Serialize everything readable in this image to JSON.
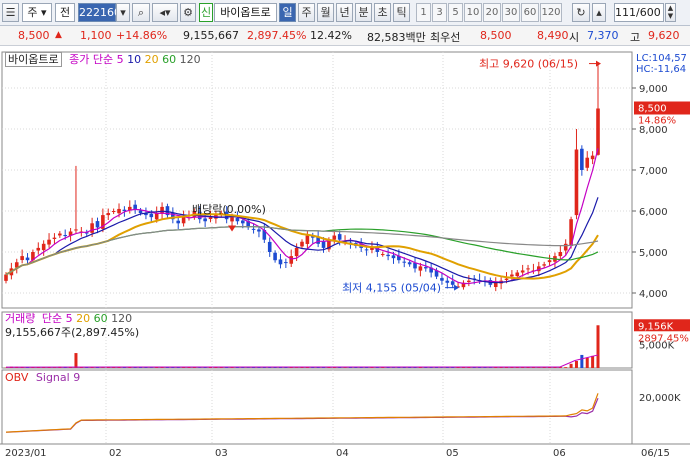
{
  "toolbar": {
    "market_prefix": "주",
    "prefix2": "전",
    "code": "222160",
    "badge": "신",
    "name": "바이옵트로",
    "periods": [
      "일",
      "주",
      "월",
      "년",
      "분",
      "초",
      "틱"
    ],
    "active_period": "일",
    "nums": [
      "1",
      "3",
      "5",
      "10",
      "20",
      "30",
      "60",
      "120"
    ],
    "counter": "111/600"
  },
  "quote": {
    "price": "8,500",
    "change": "1,100",
    "change_pct": "+14.86%",
    "volume": "9,155,667",
    "volume_pct": "2,897.45%",
    "turnover_rate": "12.42%",
    "amount": "82,583백만",
    "bid_label": "최우선",
    "ask": "8,500",
    "bid": "8,490",
    "open_label": "시",
    "open": "7,370",
    "high_label": "고",
    "high": "9,620"
  },
  "price_panel": {
    "name_label": "바이옵트로",
    "ma_label": "종가 단순",
    "ma_periods": [
      "5",
      "10",
      "20",
      "60",
      "120"
    ],
    "ma_colors": [
      "#c400c4",
      "#1a1aaa",
      "#e0a000",
      "#2aa02a",
      "#555555"
    ],
    "annot_high": "최고 9,620 (06/15)",
    "annot_low": "최저 4,155 (05/04)",
    "annot_div": "배당락(0.00%)",
    "lc_label": "LC:104,57",
    "hc_label": "HC:-11,64",
    "last_price": "8,500",
    "last_pct": "14.86%",
    "y_ticks": [
      "9,000",
      "8,000",
      "7,000",
      "6,000",
      "5,000",
      "4,000"
    ]
  },
  "volume_panel": {
    "label": "거래량",
    "ma_label": "단순",
    "ma_periods": [
      "5",
      "20",
      "60",
      "120"
    ],
    "info": "9,155,667주(2,897.45%)",
    "last": "9,156K",
    "last_pct": "2897.45%",
    "y_tick": "5,000K"
  },
  "obv_panel": {
    "label": "OBV",
    "signal_label": "Signal 9",
    "y_tick": "20,000K"
  },
  "x_axis": [
    "2023/01",
    "02",
    "03",
    "04",
    "05",
    "06",
    "06/15"
  ],
  "colors": {
    "up": "#e0261b",
    "down": "#1d4bd1",
    "grid": "#d9d9d9"
  },
  "chart_data": {
    "type": "candlestick",
    "x": [
      "2023/01",
      "02",
      "03",
      "04",
      "05",
      "06"
    ],
    "close_series": [
      4.45,
      4.6,
      4.75,
      4.9,
      4.8,
      5.0,
      5.1,
      5.2,
      5.3,
      5.35,
      5.45,
      5.4,
      5.5,
      5.55,
      5.5,
      5.45,
      5.7,
      5.6,
      5.9,
      5.95,
      6.0,
      6.05,
      6.0,
      6.1,
      6.05,
      5.95,
      5.9,
      5.85,
      5.95,
      6.1,
      5.9,
      5.8,
      5.7,
      5.85,
      5.9,
      6.0,
      5.8,
      5.75,
      5.85,
      5.9,
      5.95,
      5.8,
      5.85,
      5.75,
      5.7,
      5.6,
      5.55,
      5.5,
      5.3,
      5.0,
      4.8,
      4.7,
      4.75,
      4.9,
      5.1,
      5.25,
      5.4,
      5.35,
      5.2,
      5.1,
      5.3,
      5.4,
      5.3,
      5.25,
      5.2,
      5.15,
      5.1,
      5.05,
      5.1,
      5.0,
      4.95,
      4.9,
      4.85,
      4.8,
      4.75,
      4.7,
      4.6,
      4.65,
      4.6,
      4.5,
      4.4,
      4.3,
      4.25,
      4.2,
      4.16,
      4.25,
      4.3,
      4.35,
      4.3,
      4.28,
      4.2,
      4.25,
      4.3,
      4.35,
      4.45,
      4.5,
      4.55,
      4.6,
      4.55,
      4.65,
      4.7,
      4.8,
      4.9,
      5.0,
      5.2,
      5.8,
      7.5,
      7.0,
      7.3,
      7.35,
      8.5
    ],
    "high": 9620,
    "low": 4155,
    "last": 8500
  }
}
